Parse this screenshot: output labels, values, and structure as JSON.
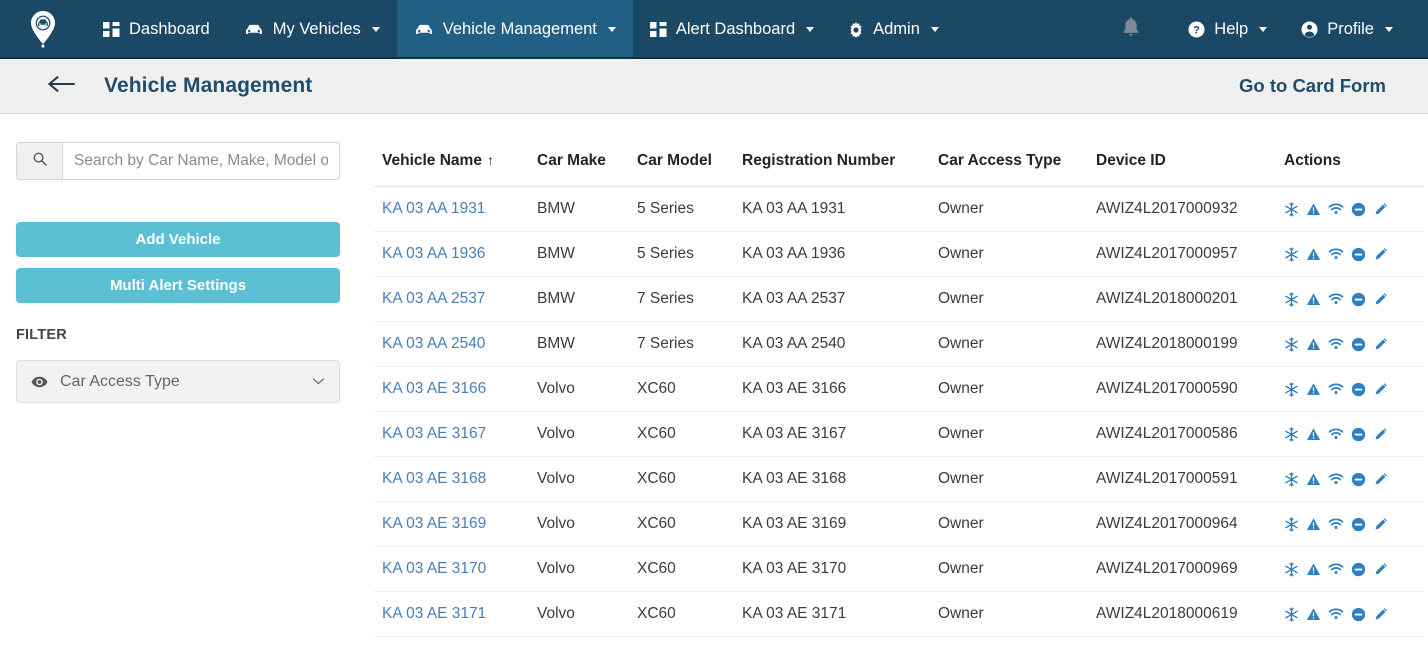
{
  "navbar": {
    "brand_icon": "map-pin-car-logo",
    "items": [
      {
        "label": "Dashboard",
        "icon": "grid-icon",
        "caret": false,
        "active": false
      },
      {
        "label": "My Vehicles",
        "icon": "car-icon",
        "caret": true,
        "active": false
      },
      {
        "label": "Vehicle Management",
        "icon": "car-icon",
        "caret": true,
        "active": true
      },
      {
        "label": "Alert Dashboard",
        "icon": "grid-icon",
        "caret": true,
        "active": false
      },
      {
        "label": "Admin",
        "icon": "gear-icon",
        "caret": true,
        "active": false
      }
    ],
    "right_items": [
      {
        "label": "Help",
        "icon": "question-circle-icon",
        "caret": true
      },
      {
        "label": "Profile",
        "icon": "user-circle-icon",
        "caret": true
      }
    ],
    "notification_icon": "bell-icon",
    "bg_color": "#1b4965",
    "active_color": "#225f84"
  },
  "subheader": {
    "back_icon": "arrow-left-icon",
    "title": "Vehicle Management",
    "card_form_label": "Go to Card Form",
    "bg_color": "#f0f0f0",
    "title_color": "#1f4e6d"
  },
  "sidebar": {
    "search": {
      "icon": "search-icon",
      "placeholder": "Search by Car Name, Make, Model o",
      "value": ""
    },
    "add_vehicle_label": "Add Vehicle",
    "multi_alert_label": "Multi Alert Settings",
    "button_color": "#5bc0d4",
    "filter_heading": "FILTER",
    "filter_select": {
      "icon": "eye-icon",
      "selected": "Car Access Type",
      "chevron": "chevron-down-icon"
    }
  },
  "table": {
    "columns": [
      {
        "label": "Vehicle Name",
        "sorted": true,
        "sort_dir": "asc"
      },
      {
        "label": "Car Make",
        "sorted": false
      },
      {
        "label": "Car Model",
        "sorted": false
      },
      {
        "label": "Registration Number",
        "sorted": false
      },
      {
        "label": "Car Access Type",
        "sorted": false
      },
      {
        "label": "Device ID",
        "sorted": false
      },
      {
        "label": "Actions",
        "sorted": false
      }
    ],
    "sort_arrow_glyph": "↑",
    "link_color": "#4a7fb5",
    "action_icons": [
      "snowflake-icon",
      "warning-triangle-icon",
      "wifi-icon",
      "minus-circle-icon",
      "pencil-edit-icon"
    ],
    "action_icon_color": "#2f7fc1",
    "rows": [
      {
        "vehicle_name": "KA 03 AA 1931",
        "car_make": "BMW",
        "car_model": "5 Series",
        "registration_number": "KA 03 AA 1931",
        "car_access_type": "Owner",
        "device_id": "AWIZ4L2017000932"
      },
      {
        "vehicle_name": "KA 03 AA 1936",
        "car_make": "BMW",
        "car_model": "5 Series",
        "registration_number": "KA 03 AA 1936",
        "car_access_type": "Owner",
        "device_id": "AWIZ4L2017000957"
      },
      {
        "vehicle_name": "KA 03 AA 2537",
        "car_make": "BMW",
        "car_model": "7 Series",
        "registration_number": "KA 03 AA 2537",
        "car_access_type": "Owner",
        "device_id": "AWIZ4L2018000201"
      },
      {
        "vehicle_name": "KA 03 AA 2540",
        "car_make": "BMW",
        "car_model": "7 Series",
        "registration_number": "KA 03 AA 2540",
        "car_access_type": "Owner",
        "device_id": "AWIZ4L2018000199"
      },
      {
        "vehicle_name": "KA 03 AE 3166",
        "car_make": "Volvo",
        "car_model": "XC60",
        "registration_number": "KA 03 AE 3166",
        "car_access_type": "Owner",
        "device_id": "AWIZ4L2017000590"
      },
      {
        "vehicle_name": "KA 03 AE 3167",
        "car_make": "Volvo",
        "car_model": "XC60",
        "registration_number": "KA 03 AE 3167",
        "car_access_type": "Owner",
        "device_id": "AWIZ4L2017000586"
      },
      {
        "vehicle_name": "KA 03 AE 3168",
        "car_make": "Volvo",
        "car_model": "XC60",
        "registration_number": "KA 03 AE 3168",
        "car_access_type": "Owner",
        "device_id": "AWIZ4L2017000591"
      },
      {
        "vehicle_name": "KA 03 AE 3169",
        "car_make": "Volvo",
        "car_model": "XC60",
        "registration_number": "KA 03 AE 3169",
        "car_access_type": "Owner",
        "device_id": "AWIZ4L2017000964"
      },
      {
        "vehicle_name": "KA 03 AE 3170",
        "car_make": "Volvo",
        "car_model": "XC60",
        "registration_number": "KA 03 AE 3170",
        "car_access_type": "Owner",
        "device_id": "AWIZ4L2017000969"
      },
      {
        "vehicle_name": "KA 03 AE 3171",
        "car_make": "Volvo",
        "car_model": "XC60",
        "registration_number": "KA 03 AE 3171",
        "car_access_type": "Owner",
        "device_id": "AWIZ4L2018000619"
      }
    ]
  }
}
